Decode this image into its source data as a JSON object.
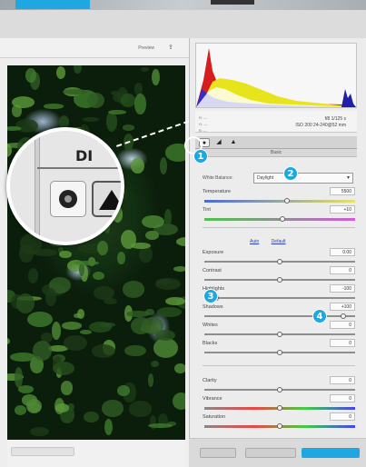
{
  "preview": {
    "toolbar_label": "Preview",
    "toolbar_icon": "export-icon",
    "zoom_callout_text": "DI"
  },
  "info": {
    "col1_lines": [
      "R:  ---",
      "G:  ---",
      "B:  ---"
    ],
    "line1": "f/8  1/125 s",
    "line2": "ISO 200  24-240@52 mm"
  },
  "tabs": [
    "●",
    "◢",
    "▲"
  ],
  "panel": {
    "section_title": "Basic",
    "white_balance": {
      "label": "White Balance:",
      "value": "Daylight"
    },
    "auto_label": "Auto",
    "default_label": "Default"
  },
  "sliders": [
    {
      "name": "temperature",
      "label": "Temperature",
      "value": "5500",
      "pos": 0.55,
      "track": "temp"
    },
    {
      "name": "tint",
      "label": "Tint",
      "value": "+10",
      "pos": 0.52,
      "track": "tint"
    },
    {
      "name": "exposure",
      "label": "Exposure",
      "value": "0.00",
      "pos": 0.5,
      "track": ""
    },
    {
      "name": "contrast",
      "label": "Contrast",
      "value": "0",
      "pos": 0.5,
      "track": ""
    },
    {
      "name": "highlights",
      "label": "Highlights",
      "value": "-100",
      "pos": 0.08,
      "track": ""
    },
    {
      "name": "shadows",
      "label": "Shadows",
      "value": "+100",
      "pos": 0.92,
      "track": ""
    },
    {
      "name": "whites",
      "label": "Whites",
      "value": "0",
      "pos": 0.5,
      "track": ""
    },
    {
      "name": "blacks",
      "label": "Blacks",
      "value": "0",
      "pos": 0.5,
      "track": ""
    },
    {
      "name": "clarity",
      "label": "Clarity",
      "value": "0",
      "pos": 0.5,
      "track": ""
    },
    {
      "name": "vibrance",
      "label": "Vibrance",
      "value": "0",
      "pos": 0.5,
      "track": "sat"
    },
    {
      "name": "saturation",
      "label": "Saturation",
      "value": "0",
      "pos": 0.5,
      "track": "sat"
    }
  ],
  "badges": [
    "1",
    "2",
    "3",
    "4"
  ],
  "colors": {
    "accent": "#1ea7e1",
    "link": "#2a3fb0"
  }
}
